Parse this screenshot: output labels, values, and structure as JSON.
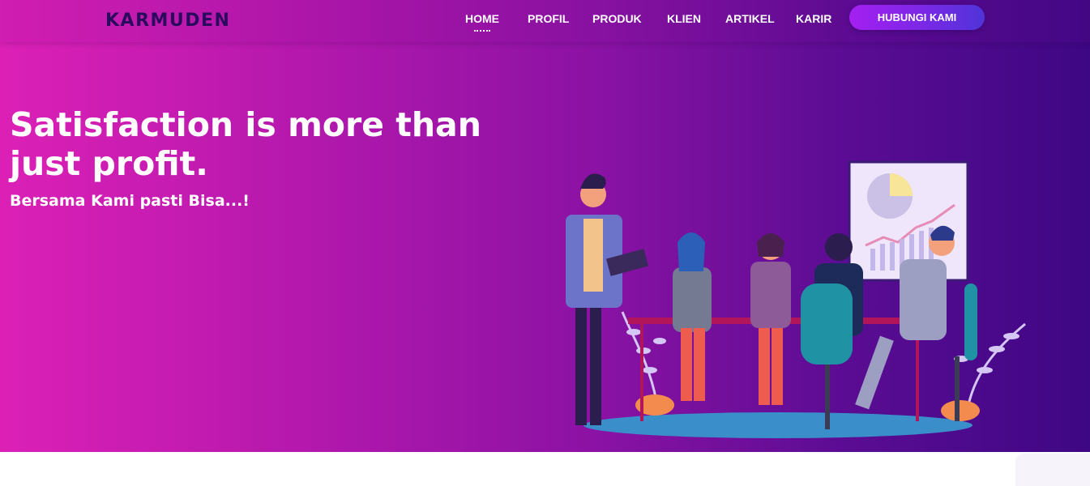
{
  "brand": {
    "logo_text": "KARMUDEN"
  },
  "nav": {
    "items": [
      {
        "label": "HOME",
        "active": true
      },
      {
        "label": "PROFIL"
      },
      {
        "label": "PRODUK"
      },
      {
        "label": "KLIEN"
      },
      {
        "label": "ARTIKEL"
      },
      {
        "label": "KARIR"
      }
    ],
    "cta_label": "HUBUNGI KAMI"
  },
  "hero": {
    "headline": "Satisfaction is more than just profit.",
    "subheadline": "Bersama Kami pasti Bisa...!"
  },
  "colors": {
    "gradient_start": "#dc20b6",
    "gradient_end": "#3e0784",
    "logo": "#2a0b5e",
    "cta_start": "#a51ff0",
    "cta_end": "#4f34d8"
  }
}
